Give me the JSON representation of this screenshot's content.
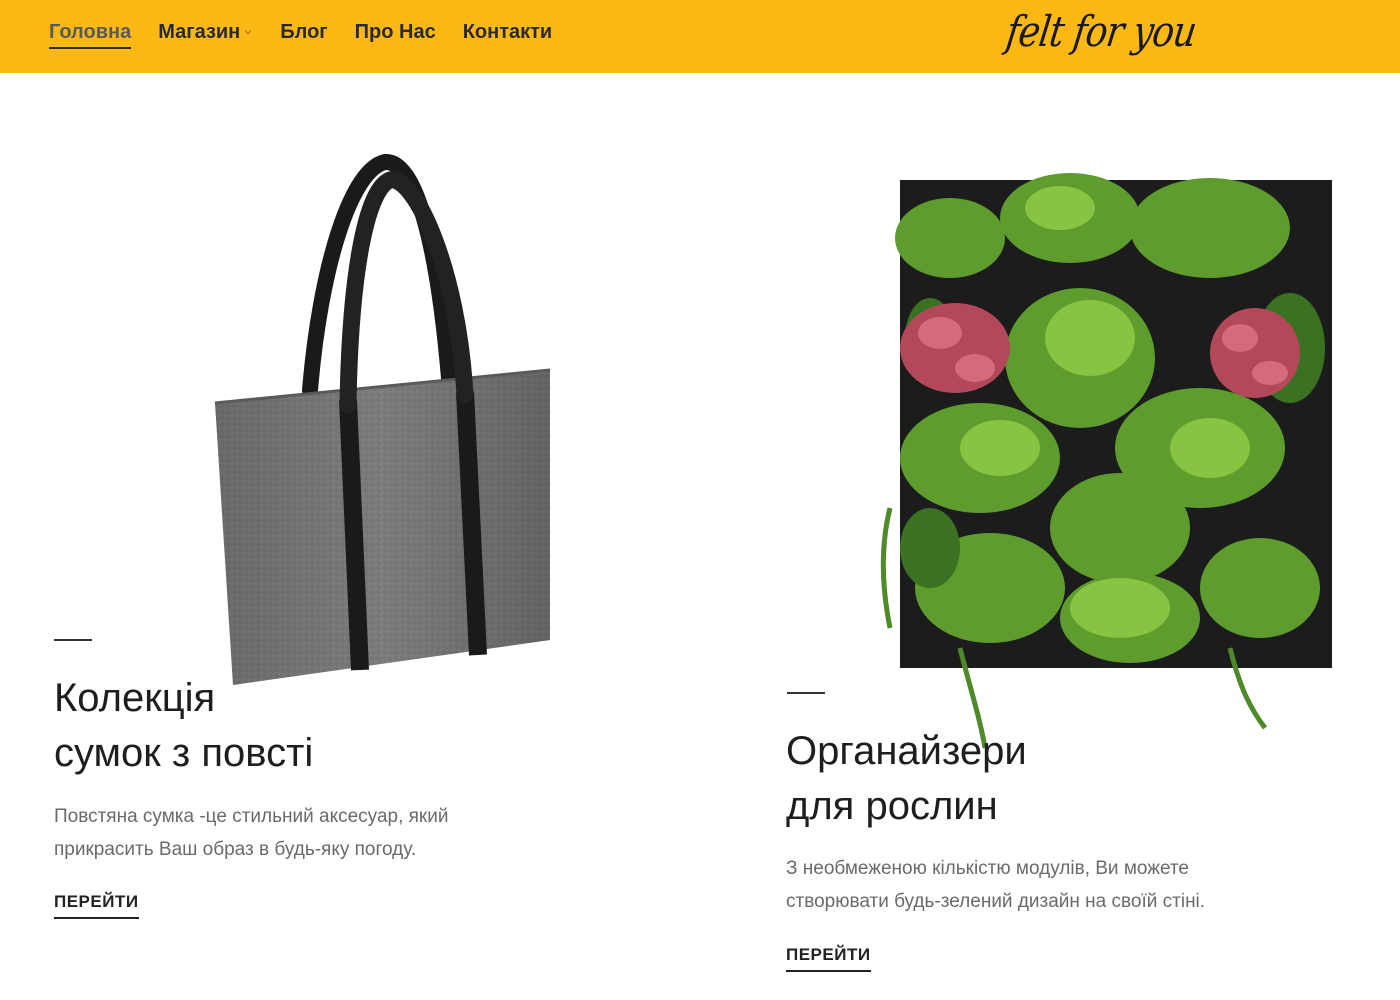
{
  "nav": {
    "items": [
      {
        "label": "Головна",
        "active": true
      },
      {
        "label": "Магазин",
        "has_dropdown": true
      },
      {
        "label": "Блог"
      },
      {
        "label": "Про Нас"
      },
      {
        "label": "Контакти"
      }
    ]
  },
  "logo": {
    "text": "felt for you"
  },
  "colors": {
    "header_bg": "#fdb813",
    "text_dark": "#1e1e1e",
    "text_muted": "#6a6a6a"
  },
  "cards": [
    {
      "title_lines": [
        "Колекція",
        "сумок з повсті"
      ],
      "desc_lines": [
        "Повстяна сумка -це стильний аксесуар, який",
        "прикрасить Ваш образ в будь-яку погоду."
      ],
      "link": "ПЕРЕЙТИ",
      "image": "felt-tote-bag"
    },
    {
      "title_lines": [
        "Органайзери",
        "для рослин"
      ],
      "desc_lines": [
        "З необмеженою кількістю модулів, Ви можете",
        "створювати будь-зелений дизайн на своїй стіні."
      ],
      "link": "ПЕРЕЙТИ",
      "image": "vertical-plant-wall-organizer"
    }
  ]
}
